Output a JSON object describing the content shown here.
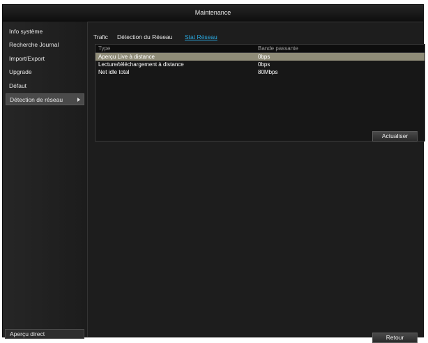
{
  "window": {
    "title": "Maintenance"
  },
  "sidebar": {
    "items": [
      {
        "label": "Info système"
      },
      {
        "label": "Recherche Journal"
      },
      {
        "label": "Import/Export"
      },
      {
        "label": "Upgrade"
      },
      {
        "label": "Défaut"
      },
      {
        "label": "Détection de réseau",
        "active": true
      }
    ],
    "bottom_label": "Aperçu direct"
  },
  "tabs": [
    {
      "label": "Trafic"
    },
    {
      "label": "Détection du Réseau"
    },
    {
      "label": "Stat Réseau",
      "active": true
    }
  ],
  "table": {
    "headers": [
      "Type",
      "Bande passante"
    ],
    "rows": [
      {
        "type": "Aperçu Live à distance",
        "bandwidth": "0bps",
        "selected": true
      },
      {
        "type": "Lecture/téléchargement à distance",
        "bandwidth": "0bps"
      },
      {
        "type": "Net idle total",
        "bandwidth": "80Mbps"
      }
    ]
  },
  "buttons": {
    "update": "Actualiser",
    "back": "Retour"
  },
  "colors": {
    "accent": "#2aa8df",
    "selected_row": "#8f8c78",
    "background": "#1d1d1d"
  }
}
